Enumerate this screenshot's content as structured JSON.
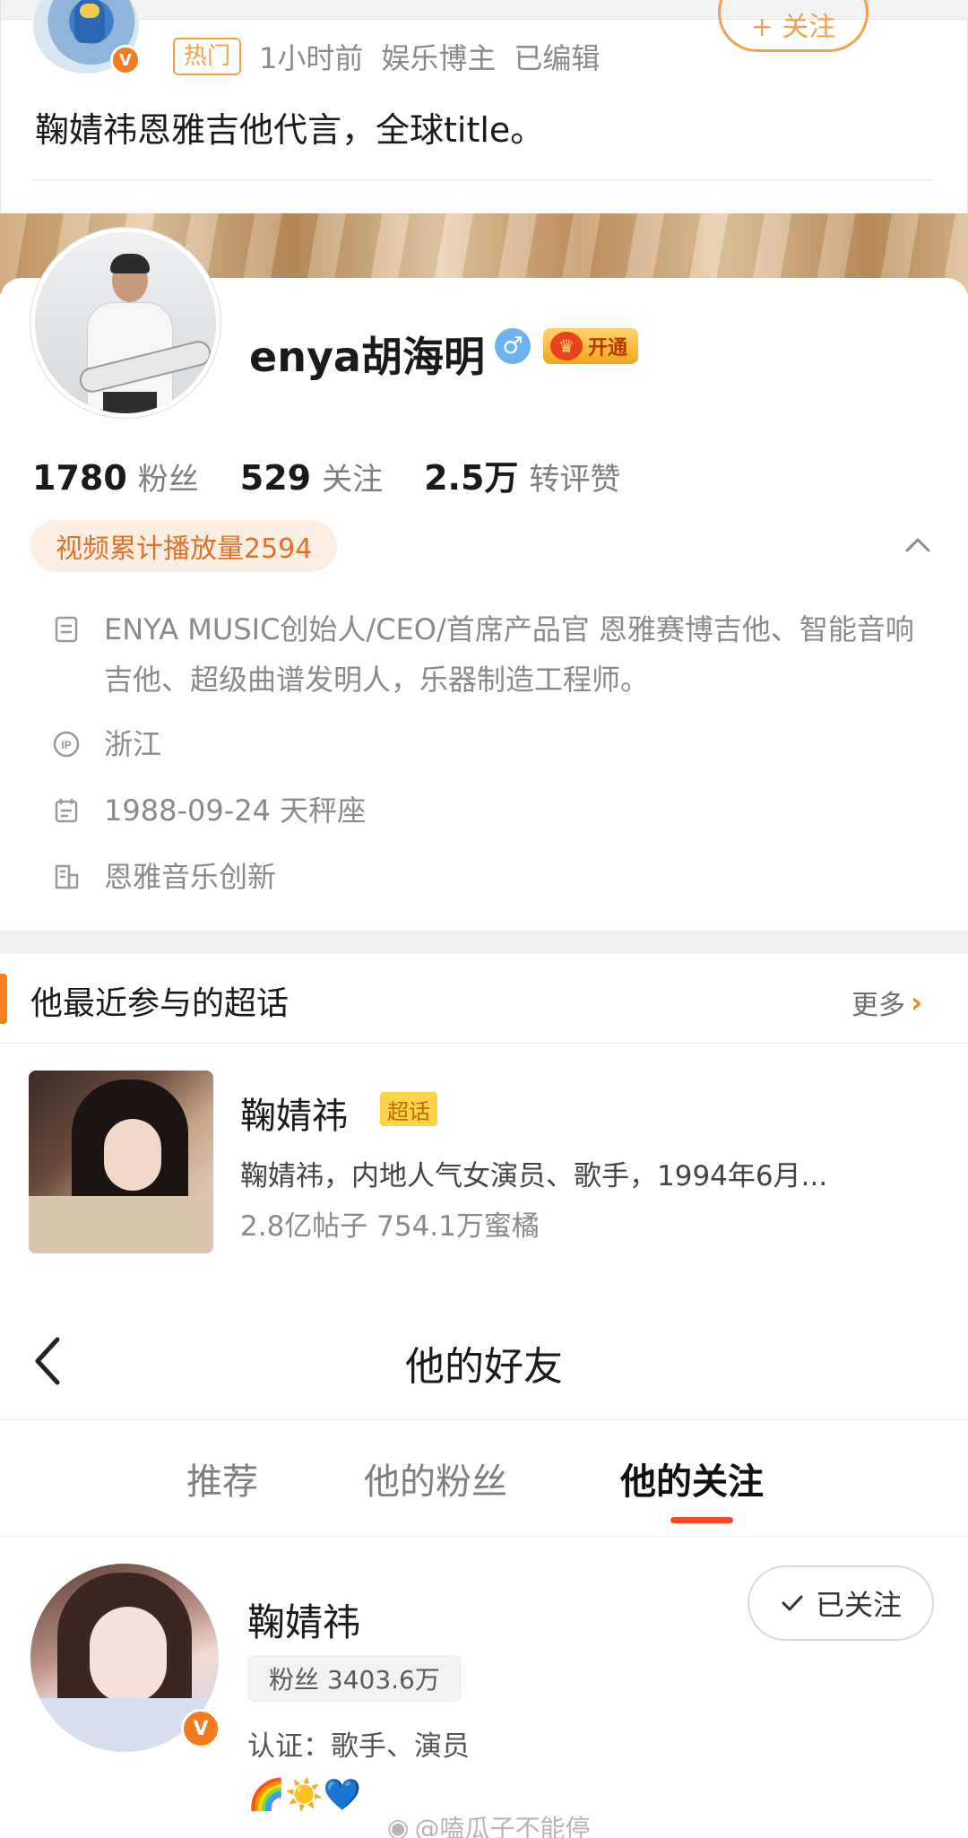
{
  "post": {
    "hot_tag": "热门",
    "time": "1小时前",
    "author_type": "娱乐博主",
    "edited": "已编辑",
    "follow_label": "+ 关注",
    "text": "鞠婧祎恩雅吉他代言，全球title。",
    "verified_badge": "V"
  },
  "profile": {
    "name": "enya胡海明",
    "gender_symbol": "♂",
    "vip_label": "开通",
    "stats": [
      {
        "num": "1780",
        "label": "粉丝"
      },
      {
        "num": "529",
        "label": "关注"
      },
      {
        "num": "2.5万",
        "label": "转评赞"
      }
    ],
    "video_plays": "视频累计播放量2594",
    "bio": "ENYA MUSIC创始人/CEO/首席产品官 恩雅赛博吉他、智能音响吉他、超级曲谱发明人，乐器制造工程师。",
    "ip": "浙江",
    "birthday": "1988-09-24 天秤座",
    "company": "恩雅音乐创新",
    "ip_icon_text": "IP"
  },
  "super_topics": {
    "title": "他最近参与的超话",
    "more_label": "更多",
    "item": {
      "name": "鞠婧祎",
      "tag": "超话",
      "desc": "鞠婧祎，内地人气女演员、歌手，1994年6月...",
      "stats": "2.8亿帖子 754.1万蜜橘"
    }
  },
  "friends": {
    "title": "他的好友",
    "tabs": [
      "推荐",
      "他的粉丝",
      "他的关注"
    ],
    "active_tab": "他的关注",
    "row": {
      "name": "鞠婧祎",
      "fans": "粉丝 3403.6万",
      "verify": "认证：歌手、演员",
      "emojis": "🌈☀️💙",
      "follow_status": "已关注",
      "verified_badge": "V"
    }
  },
  "watermark": "@嗑瓜子不能停",
  "colors": {
    "accent_orange": "#f5821f",
    "tab_underline": "#f24a2c",
    "video_pill_text": "#e0712b"
  }
}
